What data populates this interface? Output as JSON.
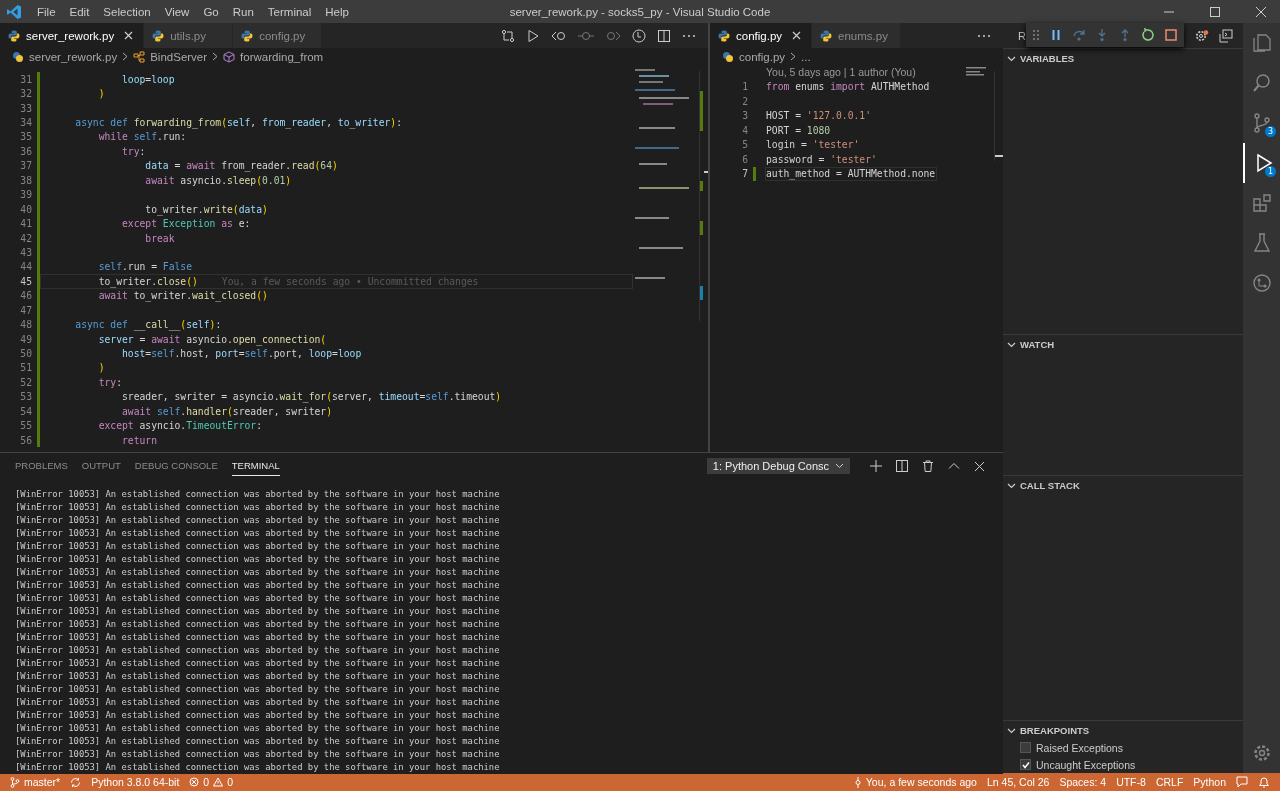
{
  "window": {
    "title": "server_rework.py - socks5_py - Visual Studio Code"
  },
  "menu": [
    "File",
    "Edit",
    "Selection",
    "View",
    "Go",
    "Run",
    "Terminal",
    "Help"
  ],
  "left_editor": {
    "tabs": [
      {
        "label": "server_rework.py",
        "selected": true
      },
      {
        "label": "utils.py",
        "selected": false
      },
      {
        "label": "config.py",
        "selected": false
      }
    ],
    "breadcrumb": [
      {
        "label": "server_rework.py",
        "kind": "file"
      },
      {
        "label": "BindServer",
        "kind": "class"
      },
      {
        "label": "forwarding_from",
        "kind": "method"
      }
    ],
    "lines": [
      {
        "n": "31",
        "current": false,
        "tokens": [
          {
            "text": "            loop",
            "kind": "var"
          },
          {
            "text": "=",
            "kind": "txt"
          },
          {
            "text": "loop",
            "kind": "var"
          }
        ]
      },
      {
        "n": "32",
        "current": false,
        "tokens": [
          {
            "text": "        )",
            "kind": "br"
          }
        ]
      },
      {
        "n": "33",
        "current": false
      },
      {
        "n": "34",
        "current": false,
        "tokens": [
          {
            "text": "    async",
            "kind": "def"
          },
          {
            "text": " def",
            "kind": "def"
          },
          {
            "text": " forwarding_from",
            "kind": "fn"
          },
          {
            "text": "(",
            "kind": "br"
          },
          {
            "text": "self",
            "kind": "var"
          },
          {
            "text": ", ",
            "kind": "txt"
          },
          {
            "text": "from_reader",
            "kind": "var"
          },
          {
            "text": ", ",
            "kind": "txt"
          },
          {
            "text": "to_writer",
            "kind": "var"
          },
          {
            "text": ")",
            "kind": "br"
          },
          {
            "text": ":",
            "kind": "txt"
          }
        ]
      },
      {
        "n": "35",
        "current": false,
        "tokens": [
          {
            "text": "        while",
            "kind": "kw"
          },
          {
            "text": " self",
            "kind": "def"
          },
          {
            "text": ".run:",
            "kind": "txt"
          }
        ]
      },
      {
        "n": "36",
        "current": false,
        "tokens": [
          {
            "text": "            try",
            "kind": "kw"
          },
          {
            "text": ":",
            "kind": "txt"
          }
        ]
      },
      {
        "n": "37",
        "current": false,
        "tokens": [
          {
            "text": "                data",
            "kind": "var"
          },
          {
            "text": " = ",
            "kind": "txt"
          },
          {
            "text": "await",
            "kind": "kw"
          },
          {
            "text": " from_reader.",
            "kind": "txt"
          },
          {
            "text": "read",
            "kind": "fn"
          },
          {
            "text": "(",
            "kind": "br"
          },
          {
            "text": "64",
            "kind": "num"
          },
          {
            "text": ")",
            "kind": "br"
          }
        ]
      },
      {
        "n": "38",
        "current": false,
        "tokens": [
          {
            "text": "                await",
            "kind": "kw"
          },
          {
            "text": " asyncio.",
            "kind": "txt"
          },
          {
            "text": "sleep",
            "kind": "fn"
          },
          {
            "text": "(",
            "kind": "br"
          },
          {
            "text": "0.01",
            "kind": "num"
          },
          {
            "text": ")",
            "kind": "br"
          }
        ]
      },
      {
        "n": "39",
        "current": false
      },
      {
        "n": "40",
        "current": false,
        "tokens": [
          {
            "text": "                to_writer.",
            "kind": "txt"
          },
          {
            "text": "write",
            "kind": "fn"
          },
          {
            "text": "(",
            "kind": "br"
          },
          {
            "text": "data",
            "kind": "var"
          },
          {
            "text": ")",
            "kind": "br"
          }
        ]
      },
      {
        "n": "41",
        "current": false,
        "tokens": [
          {
            "text": "            except",
            "kind": "kw"
          },
          {
            "text": " Exception",
            "kind": "cls"
          },
          {
            "text": " as",
            "kind": "kw"
          },
          {
            "text": " e:",
            "kind": "txt"
          }
        ]
      },
      {
        "n": "42",
        "current": false,
        "tokens": [
          {
            "text": "                break",
            "kind": "kw"
          }
        ]
      },
      {
        "n": "43",
        "current": false
      },
      {
        "n": "44",
        "current": false,
        "tokens": [
          {
            "text": "        self",
            "kind": "def"
          },
          {
            "text": ".run = ",
            "kind": "txt"
          },
          {
            "text": "False",
            "kind": "def"
          }
        ]
      },
      {
        "n": "45",
        "current": true,
        "tokens": [
          {
            "text": "        to_writer.",
            "kind": "txt"
          },
          {
            "text": "close",
            "kind": "fn"
          },
          {
            "text": "()",
            "kind": "br"
          }
        ],
        "annotation": "You, a few seconds ago • Uncommitted changes"
      },
      {
        "n": "46",
        "current": false,
        "tokens": [
          {
            "text": "        await",
            "kind": "kw"
          },
          {
            "text": " to_writer.",
            "kind": "txt"
          },
          {
            "text": "wait_closed",
            "kind": "fn"
          },
          {
            "text": "()",
            "kind": "br"
          }
        ]
      },
      {
        "n": "47",
        "current": false
      },
      {
        "n": "48",
        "current": false,
        "tokens": [
          {
            "text": "    async",
            "kind": "def"
          },
          {
            "text": " def",
            "kind": "def"
          },
          {
            "text": " __call__",
            "kind": "fn"
          },
          {
            "text": "(",
            "kind": "br"
          },
          {
            "text": "self",
            "kind": "var"
          },
          {
            "text": ")",
            "kind": "br"
          },
          {
            "text": ":",
            "kind": "txt"
          }
        ]
      },
      {
        "n": "49",
        "current": false,
        "tokens": [
          {
            "text": "        server",
            "kind": "var"
          },
          {
            "text": " = ",
            "kind": "txt"
          },
          {
            "text": "await",
            "kind": "kw"
          },
          {
            "text": " asyncio.",
            "kind": "txt"
          },
          {
            "text": "open_connection",
            "kind": "fn"
          },
          {
            "text": "(",
            "kind": "br"
          }
        ]
      },
      {
        "n": "50",
        "current": false,
        "tokens": [
          {
            "text": "            host",
            "kind": "var"
          },
          {
            "text": "=",
            "kind": "txt"
          },
          {
            "text": "self",
            "kind": "def"
          },
          {
            "text": ".host, ",
            "kind": "txt"
          },
          {
            "text": "port",
            "kind": "var"
          },
          {
            "text": "=",
            "kind": "txt"
          },
          {
            "text": "self",
            "kind": "def"
          },
          {
            "text": ".port, ",
            "kind": "txt"
          },
          {
            "text": "loop",
            "kind": "var"
          },
          {
            "text": "=",
            "kind": "txt"
          },
          {
            "text": "loop",
            "kind": "var"
          }
        ]
      },
      {
        "n": "51",
        "current": false,
        "tokens": [
          {
            "text": "        )",
            "kind": "br"
          }
        ]
      },
      {
        "n": "52",
        "current": false,
        "tokens": [
          {
            "text": "        try",
            "kind": "kw"
          },
          {
            "text": ":",
            "kind": "txt"
          }
        ]
      },
      {
        "n": "53",
        "current": false,
        "tokens": [
          {
            "text": "            sreader, swriter = asyncio.",
            "kind": "txt"
          },
          {
            "text": "wait_for",
            "kind": "fn"
          },
          {
            "text": "(",
            "kind": "br"
          },
          {
            "text": "server, ",
            "kind": "txt"
          },
          {
            "text": "timeout",
            "kind": "var"
          },
          {
            "text": "=",
            "kind": "txt"
          },
          {
            "text": "self",
            "kind": "def"
          },
          {
            "text": ".timeout",
            "kind": "txt"
          },
          {
            "text": ")",
            "kind": "br"
          }
        ]
      },
      {
        "n": "54",
        "current": false,
        "tokens": [
          {
            "text": "            await",
            "kind": "kw"
          },
          {
            "text": " self",
            "kind": "def"
          },
          {
            "text": ".",
            "kind": "txt"
          },
          {
            "text": "handler",
            "kind": "fn"
          },
          {
            "text": "(",
            "kind": "br"
          },
          {
            "text": "sreader, swriter",
            "kind": "txt"
          },
          {
            "text": ")",
            "kind": "br"
          }
        ]
      },
      {
        "n": "55",
        "current": false,
        "tokens": [
          {
            "text": "        except",
            "kind": "kw"
          },
          {
            "text": " asyncio.",
            "kind": "txt"
          },
          {
            "text": "TimeoutError",
            "kind": "cls"
          },
          {
            "text": ":",
            "kind": "txt"
          }
        ]
      },
      {
        "n": "56",
        "current": false,
        "tokens": [
          {
            "text": "            return",
            "kind": "kw"
          }
        ]
      }
    ]
  },
  "right_editor": {
    "tabs": [
      {
        "label": "config.py",
        "selected": true
      },
      {
        "label": "enums.py",
        "selected": false
      }
    ],
    "breadcrumb": [
      {
        "label": "config.py",
        "kind": "file"
      },
      {
        "label": "...",
        "kind": "more"
      }
    ],
    "blame": "You, 5 days ago | 1 author (You)",
    "lines": [
      {
        "n": "1",
        "current": false,
        "tokens": [
          {
            "text": "from",
            "kind": "kw"
          },
          {
            "text": " enums ",
            "kind": "txt"
          },
          {
            "text": "import",
            "kind": "kw"
          },
          {
            "text": " AUTHMethod",
            "kind": "txt"
          }
        ]
      },
      {
        "n": "2",
        "current": false
      },
      {
        "n": "3",
        "current": false,
        "tokens": [
          {
            "text": "HOST = ",
            "kind": "txt"
          },
          {
            "text": "'127.0.0.1'",
            "kind": "str"
          }
        ]
      },
      {
        "n": "4",
        "current": false,
        "tokens": [
          {
            "text": "PORT = ",
            "kind": "txt"
          },
          {
            "text": "1080",
            "kind": "num"
          }
        ]
      },
      {
        "n": "5",
        "current": false,
        "tokens": [
          {
            "text": "login = ",
            "kind": "txt"
          },
          {
            "text": "'tester'",
            "kind": "str"
          }
        ]
      },
      {
        "n": "6",
        "current": false,
        "tokens": [
          {
            "text": "password = ",
            "kind": "txt"
          },
          {
            "text": "'tester'",
            "kind": "str"
          }
        ]
      },
      {
        "n": "7",
        "current": true,
        "tokens": [
          {
            "text": "auth_method = AUTHMethod.none",
            "kind": "txt"
          }
        ]
      }
    ]
  },
  "debug_toolbar": [
    {
      "kind": "pause",
      "disabled": false
    },
    {
      "kind": "step-over",
      "disabled": true
    },
    {
      "kind": "step-into",
      "disabled": true
    },
    {
      "kind": "step-out",
      "disabled": true
    },
    {
      "kind": "restart",
      "disabled": false
    },
    {
      "kind": "stop",
      "disabled": false
    }
  ],
  "sidebar": {
    "header": "R",
    "sections": [
      {
        "title": "VARIABLES",
        "expanded": true
      },
      {
        "title": "WATCH",
        "expanded": true
      },
      {
        "title": "CALL STACK",
        "expanded": true
      },
      {
        "title": "BREAKPOINTS",
        "expanded": true,
        "items": [
          {
            "label": "Raised Exceptions",
            "checked": false
          },
          {
            "label": "Uncaught Exceptions",
            "checked": true
          }
        ]
      }
    ]
  },
  "activity_bar": [
    {
      "kind": "explorer",
      "selected": false
    },
    {
      "kind": "search",
      "selected": false
    },
    {
      "kind": "source-control",
      "selected": false,
      "badge": "3"
    },
    {
      "kind": "debug",
      "selected": true,
      "badge": "1"
    },
    {
      "kind": "extensions",
      "selected": false
    },
    {
      "kind": "testing",
      "selected": false
    },
    {
      "kind": "git-graph",
      "selected": false
    }
  ],
  "panel": {
    "tabs": [
      {
        "label": "PROBLEMS",
        "selected": false
      },
      {
        "label": "OUTPUT",
        "selected": false
      },
      {
        "label": "DEBUG CONSOLE",
        "selected": false
      },
      {
        "label": "TERMINAL",
        "selected": true
      }
    ],
    "terminal_select": {
      "value": "1: Python Debug Consc"
    },
    "terminal_lines": [
      "[WinError 10053] An established connection was aborted by the software in your host machine",
      "[WinError 10053] An established connection was aborted by the software in your host machine",
      "[WinError 10053] An established connection was aborted by the software in your host machine",
      "[WinError 10053] An established connection was aborted by the software in your host machine",
      "[WinError 10053] An established connection was aborted by the software in your host machine",
      "[WinError 10053] An established connection was aborted by the software in your host machine",
      "[WinError 10053] An established connection was aborted by the software in your host machine",
      "[WinError 10053] An established connection was aborted by the software in your host machine",
      "[WinError 10053] An established connection was aborted by the software in your host machine",
      "[WinError 10053] An established connection was aborted by the software in your host machine",
      "[WinError 10053] An established connection was aborted by the software in your host machine",
      "[WinError 10053] An established connection was aborted by the software in your host machine",
      "[WinError 10053] An established connection was aborted by the software in your host machine",
      "[WinError 10053] An established connection was aborted by the software in your host machine",
      "[WinError 10053] An established connection was aborted by the software in your host machine",
      "[WinError 10053] An established connection was aborted by the software in your host machine",
      "[WinError 10053] An established connection was aborted by the software in your host machine",
      "[WinError 10053] An established connection was aborted by the software in your host machine",
      "[WinError 10053] An established connection was aborted by the software in your host machine",
      "[WinError 10053] An established connection was aborted by the software in your host machine",
      "[WinError 10053] An established connection was aborted by the software in your host machine",
      "[WinError 10053] An established connection was aborted by the software in your host machine"
    ]
  },
  "status_bar": {
    "left": [
      {
        "kind": "branch",
        "label": "master*"
      },
      {
        "kind": "sync"
      },
      {
        "kind": "text",
        "label": "Python 3.8.0 64-bit"
      },
      {
        "kind": "problems",
        "errors": "0",
        "warnings": "0"
      }
    ],
    "right": [
      {
        "kind": "blame",
        "label": "You, a few seconds ago"
      },
      {
        "kind": "text",
        "label": "Ln 45, Col 26"
      },
      {
        "kind": "text",
        "label": "Spaces: 4"
      },
      {
        "kind": "text",
        "label": "UTF-8"
      },
      {
        "kind": "text",
        "label": "CRLF"
      },
      {
        "kind": "text",
        "label": "Python"
      },
      {
        "kind": "feedback"
      },
      {
        "kind": "bell"
      }
    ]
  }
}
